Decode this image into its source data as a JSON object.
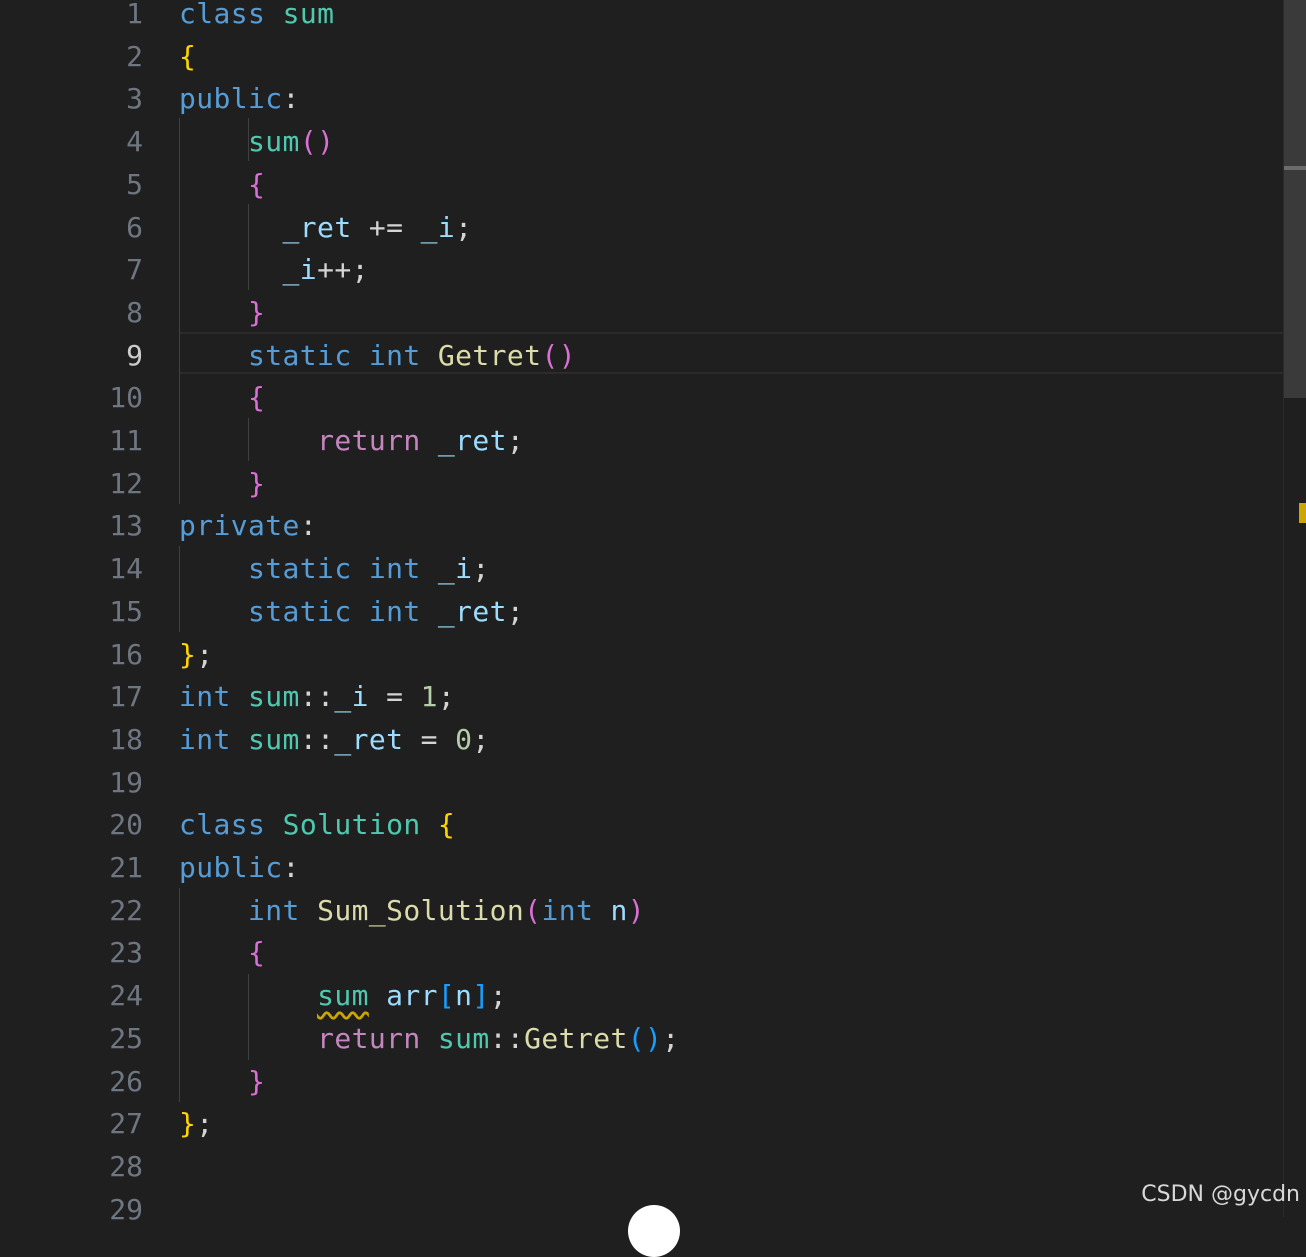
{
  "editor": {
    "active_line": 9,
    "lines": [
      {
        "n": "1",
        "t": [
          [
            "kw",
            "class"
          ],
          [
            "p",
            " "
          ],
          [
            "ty",
            "sum"
          ]
        ]
      },
      {
        "n": "2",
        "t": [
          [
            "b1",
            "{"
          ]
        ]
      },
      {
        "n": "3",
        "t": [
          [
            "kw",
            "public"
          ],
          [
            "p",
            ":"
          ]
        ]
      },
      {
        "n": "4",
        "t": [
          [
            "p",
            "    "
          ],
          [
            "ty",
            "sum"
          ],
          [
            "b2",
            "()"
          ]
        ]
      },
      {
        "n": "5",
        "t": [
          [
            "p",
            "    "
          ],
          [
            "b2",
            "{"
          ]
        ]
      },
      {
        "n": "6",
        "t": [
          [
            "p",
            "      "
          ],
          [
            "var",
            "_ret"
          ],
          [
            "p",
            " += "
          ],
          [
            "var",
            "_i"
          ],
          [
            "p",
            ";"
          ]
        ]
      },
      {
        "n": "7",
        "t": [
          [
            "p",
            "      "
          ],
          [
            "var",
            "_i"
          ],
          [
            "p",
            "++;"
          ]
        ]
      },
      {
        "n": "8",
        "t": [
          [
            "p",
            "    "
          ],
          [
            "b2",
            "}"
          ]
        ]
      },
      {
        "n": "9",
        "t": [
          [
            "p",
            "    "
          ],
          [
            "kw",
            "static"
          ],
          [
            "p",
            " "
          ],
          [
            "kw",
            "int"
          ],
          [
            "p",
            " "
          ],
          [
            "fn",
            "Getret"
          ],
          [
            "b2",
            "()"
          ]
        ]
      },
      {
        "n": "10",
        "t": [
          [
            "p",
            "    "
          ],
          [
            "b2",
            "{"
          ]
        ]
      },
      {
        "n": "11",
        "t": [
          [
            "p",
            "        "
          ],
          [
            "ctl",
            "return"
          ],
          [
            "p",
            " "
          ],
          [
            "var",
            "_ret"
          ],
          [
            "p",
            ";"
          ]
        ]
      },
      {
        "n": "12",
        "t": [
          [
            "p",
            "    "
          ],
          [
            "b2",
            "}"
          ]
        ]
      },
      {
        "n": "13",
        "t": [
          [
            "kw",
            "private"
          ],
          [
            "p",
            ":"
          ]
        ]
      },
      {
        "n": "14",
        "t": [
          [
            "p",
            "    "
          ],
          [
            "kw",
            "static"
          ],
          [
            "p",
            " "
          ],
          [
            "kw",
            "int"
          ],
          [
            "p",
            " "
          ],
          [
            "var",
            "_i"
          ],
          [
            "p",
            ";"
          ]
        ]
      },
      {
        "n": "15",
        "t": [
          [
            "p",
            "    "
          ],
          [
            "kw",
            "static"
          ],
          [
            "p",
            " "
          ],
          [
            "kw",
            "int"
          ],
          [
            "p",
            " "
          ],
          [
            "var",
            "_ret"
          ],
          [
            "p",
            ";"
          ]
        ]
      },
      {
        "n": "16",
        "t": [
          [
            "b1",
            "}"
          ],
          [
            "p",
            ";"
          ]
        ]
      },
      {
        "n": "17",
        "t": [
          [
            "kw",
            "int"
          ],
          [
            "p",
            " "
          ],
          [
            "ty",
            "sum"
          ],
          [
            "p",
            "::"
          ],
          [
            "var",
            "_i"
          ],
          [
            "p",
            " = "
          ],
          [
            "num",
            "1"
          ],
          [
            "p",
            ";"
          ]
        ]
      },
      {
        "n": "18",
        "t": [
          [
            "kw",
            "int"
          ],
          [
            "p",
            " "
          ],
          [
            "ty",
            "sum"
          ],
          [
            "p",
            "::"
          ],
          [
            "var",
            "_ret"
          ],
          [
            "p",
            " = "
          ],
          [
            "num",
            "0"
          ],
          [
            "p",
            ";"
          ]
        ]
      },
      {
        "n": "19",
        "t": []
      },
      {
        "n": "20",
        "t": [
          [
            "kw",
            "class"
          ],
          [
            "p",
            " "
          ],
          [
            "ty",
            "Solution"
          ],
          [
            "p",
            " "
          ],
          [
            "b1",
            "{"
          ]
        ]
      },
      {
        "n": "21",
        "t": [
          [
            "kw",
            "public"
          ],
          [
            "p",
            ":"
          ]
        ]
      },
      {
        "n": "22",
        "t": [
          [
            "p",
            "    "
          ],
          [
            "kw",
            "int"
          ],
          [
            "p",
            " "
          ],
          [
            "fn",
            "Sum_Solution"
          ],
          [
            "b2",
            "("
          ],
          [
            "kw",
            "int"
          ],
          [
            "p",
            " "
          ],
          [
            "var",
            "n"
          ],
          [
            "b2",
            ")"
          ]
        ]
      },
      {
        "n": "23",
        "t": [
          [
            "p",
            "    "
          ],
          [
            "b2",
            "{"
          ]
        ]
      },
      {
        "n": "24",
        "t": [
          [
            "p",
            "        "
          ],
          [
            "ty squig",
            "sum"
          ],
          [
            "p",
            " "
          ],
          [
            "var",
            "arr"
          ],
          [
            "b3",
            "["
          ],
          [
            "var",
            "n"
          ],
          [
            "b3",
            "]"
          ],
          [
            "p",
            ";"
          ]
        ]
      },
      {
        "n": "25",
        "t": [
          [
            "p",
            "        "
          ],
          [
            "ctl",
            "return"
          ],
          [
            "p",
            " "
          ],
          [
            "ty",
            "sum"
          ],
          [
            "p",
            "::"
          ],
          [
            "fn",
            "Getret"
          ],
          [
            "b3",
            "()"
          ],
          [
            "p",
            ";"
          ]
        ]
      },
      {
        "n": "26",
        "t": [
          [
            "p",
            "    "
          ],
          [
            "b2",
            "}"
          ]
        ]
      },
      {
        "n": "27",
        "t": [
          [
            "b1",
            "}"
          ],
          [
            "p",
            ";"
          ]
        ]
      },
      {
        "n": "28",
        "t": []
      },
      {
        "n": "29",
        "t": []
      }
    ]
  },
  "colors": {
    "background": "#1f1f1f",
    "keyword": "#569cd6",
    "control": "#c586c0",
    "type": "#4ec9b0",
    "function": "#dcdcaa",
    "variable": "#9cdcfe",
    "number": "#b5cea8",
    "warning": "#cca700"
  },
  "watermark": {
    "text": "CSDN @gycdn"
  }
}
